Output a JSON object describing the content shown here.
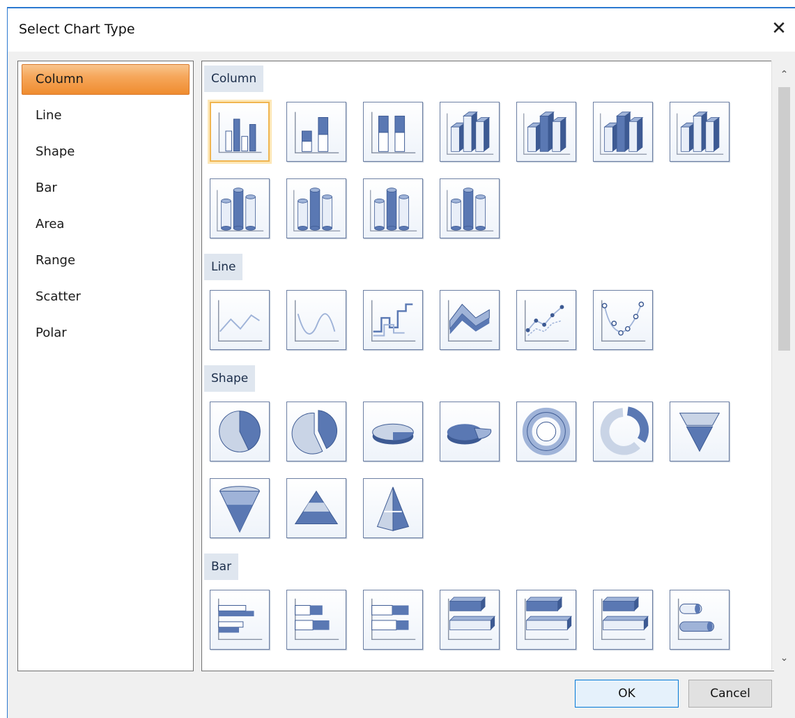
{
  "dialog": {
    "title": "Select Chart Type",
    "close_label": "✕"
  },
  "categories": [
    {
      "label": "Column",
      "selected": true
    },
    {
      "label": "Line",
      "selected": false
    },
    {
      "label": "Shape",
      "selected": false
    },
    {
      "label": "Bar",
      "selected": false
    },
    {
      "label": "Area",
      "selected": false
    },
    {
      "label": "Range",
      "selected": false
    },
    {
      "label": "Scatter",
      "selected": false
    },
    {
      "label": "Polar",
      "selected": false
    }
  ],
  "sections": [
    {
      "header": "Column",
      "items": [
        "clustered-column-icon",
        "stacked-column-icon",
        "full-stacked-column-icon",
        "3d-clustered-column-icon",
        "3d-stacked-column-icon",
        "3d-full-stacked-column-icon",
        "3d-column-icon",
        "cylinder-column-icon",
        "stacked-cylinder-icon",
        "full-stacked-cylinder-icon",
        "cylinder-3d-column-icon"
      ],
      "selected_index": 0
    },
    {
      "header": "Line",
      "items": [
        "line-chart-icon",
        "spline-chart-icon",
        "step-line-icon",
        "3d-line-icon",
        "line-markers-icon",
        "spline-markers-icon"
      ]
    },
    {
      "header": "Shape",
      "items": [
        "pie-icon",
        "exploded-pie-icon",
        "3d-pie-icon",
        "3d-exploded-pie-icon",
        "doughnut-icon",
        "exploded-doughnut-icon",
        "funnel-icon",
        "3d-funnel-icon",
        "pyramid-icon",
        "3d-pyramid-icon"
      ]
    },
    {
      "header": "Bar",
      "items": [
        "clustered-bar-icon",
        "stacked-bar-icon",
        "full-stacked-bar-icon",
        "3d-clustered-bar-icon",
        "3d-stacked-bar-icon",
        "3d-full-stacked-bar-icon",
        "cylinder-bar-icon"
      ]
    }
  ],
  "buttons": {
    "ok": "OK",
    "cancel": "Cancel"
  },
  "scrollbar": {
    "up": "⌃",
    "down": "⌄"
  },
  "colors": {
    "selected_category": "#f6a75b",
    "section_header_bg": "#dfe6ef",
    "tile_border": "#6c7fa3",
    "icon_blue": "#5a78b3",
    "ok_border": "#0078d7"
  }
}
